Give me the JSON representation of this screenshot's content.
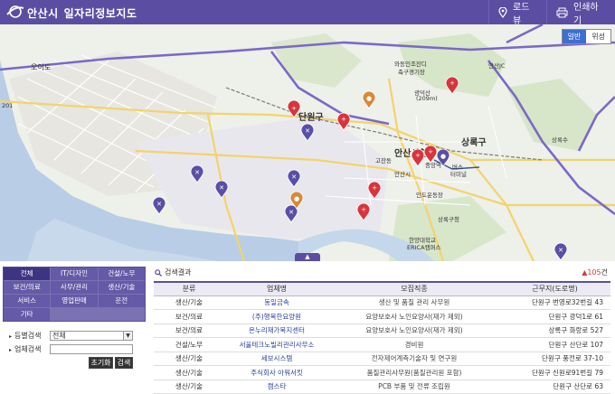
{
  "header": {
    "city": "안산시",
    "title": "일자리정보지도",
    "road_view_label": "로드뷰",
    "print_label": "인쇄하기",
    "bg_color": "#5b4ea2"
  },
  "map": {
    "view_toggle": [
      "일반",
      "위성"
    ],
    "active_view": "일반",
    "places": [
      {
        "id": "oido",
        "label": "오이도"
      },
      {
        "id": "danwon",
        "label": "단원구"
      },
      {
        "id": "ansan-city",
        "label": "안산시청"
      },
      {
        "id": "sangnok",
        "label": "상록구"
      },
      {
        "id": "wadong",
        "label": "와동인조잔디"
      },
      {
        "id": "wadong2",
        "label": "축구경기장"
      },
      {
        "id": "gwangdeok",
        "label": "광덕산"
      },
      {
        "id": "gwangdeok-h",
        "label": "(209m)"
      },
      {
        "id": "ansan-jct",
        "label": "안산JC"
      },
      {
        "id": "sangnokdo",
        "label": "상록수"
      },
      {
        "id": "jungang",
        "label": "중앙역"
      },
      {
        "id": "cheol",
        "label": "인도운동장"
      },
      {
        "id": "sangnokgu",
        "label": "상록구청"
      },
      {
        "id": "hanyang",
        "label": "한양대학교"
      },
      {
        "id": "erica",
        "label": "ERICA캠퍼스"
      },
      {
        "id": "ansanshi",
        "label": "안산시"
      },
      {
        "id": "gojan",
        "label": "고잔동"
      },
      {
        "id": "bus",
        "label": "버스"
      },
      {
        "id": "terminal",
        "label": "터미널"
      },
      {
        "id": "route201",
        "label": "201"
      }
    ],
    "collapse_label": "▲"
  },
  "categories": {
    "items": [
      "전체",
      "IT/디자인",
      "건설/노무",
      "보건/의료",
      "사무/관리",
      "생산/기술",
      "서비스",
      "영업판매",
      "운전",
      "기타"
    ],
    "active": "전체"
  },
  "search_form": {
    "type_label": "등별검색",
    "type_value": "전체",
    "company_label": "업체검색",
    "company_value": "",
    "reset_label": "초기화",
    "search_label": "검색"
  },
  "results": {
    "title": "검색결과",
    "count_value": "105",
    "count_unit": "건",
    "columns": [
      "분류",
      "업체명",
      "모집직종",
      "근무지(도로명)"
    ],
    "rows": [
      [
        "생산/기술",
        "동일금속",
        "생산 및 품질 관리 사무원",
        "단원구 번영로32번길 43"
      ],
      [
        "보건/의료",
        "(주)행복한요양원",
        "요양보호사 노인요양사(재가 제외)",
        "단원구 광덕1로 61"
      ],
      [
        "보건/의료",
        "온누리재가복지센터",
        "요양보호사 노인요양사(재가 제외)",
        "상록구 화랑로 527"
      ],
      [
        "건설/노무",
        "서울테크노빌리관리사무소",
        "경비원",
        "단원구 산단로 107"
      ],
      [
        "생산/기술",
        "세보시스템",
        "전자제어계측기술자 및 연구원",
        "단원구 풍전로 37-10"
      ],
      [
        "생산/기술",
        "주식회사 아워서킷",
        "품질관리사무원(품질관리원 포함)",
        "단원구 신원로91번길 79"
      ],
      [
        "생산/기술",
        "캠스타",
        "PCB 부품 및 전류 조립원",
        "단원구 산단로 63"
      ]
    ]
  },
  "colors": {
    "accent": "#5b4ea2",
    "marker_purple": "#5a4fa6",
    "marker_red": "#d8343c",
    "marker_orange": "#d68a3a"
  }
}
